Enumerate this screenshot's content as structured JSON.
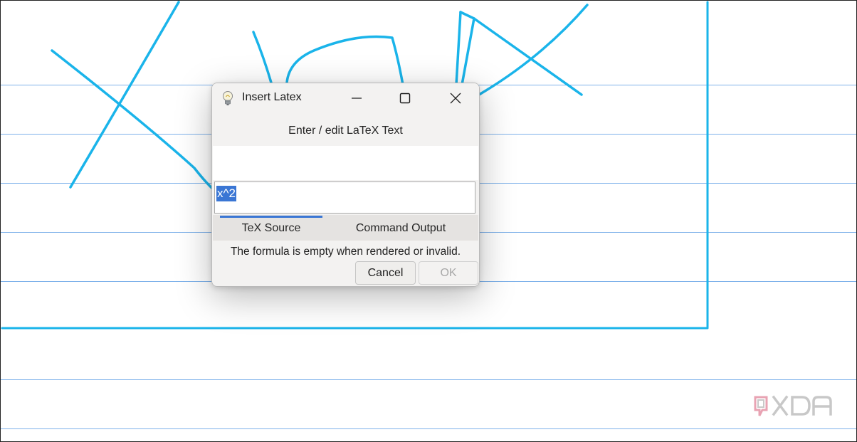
{
  "dialog": {
    "title": "Insert Latex",
    "heading": "Enter / edit LaTeX Text",
    "input_value": "x^2",
    "tabs": [
      {
        "label": "TeX Source",
        "selected": true
      },
      {
        "label": "Command Output",
        "selected": false
      }
    ],
    "status": "The formula is empty when rendered or invalid.",
    "cancel_label": "Cancel",
    "ok_label": "OK",
    "window_controls": [
      "minimize-icon",
      "maximize-icon",
      "close-icon"
    ],
    "app_icon": "lightbulb-icon"
  },
  "canvas": {
    "ink_color": "#1ab4ea",
    "rule_color": "#7fb2ea",
    "handwriting": "X^2"
  },
  "watermark": {
    "text": "XDA"
  },
  "colors": {
    "accent": "#3a76d4",
    "dialog_bg": "#f3f2f1"
  }
}
